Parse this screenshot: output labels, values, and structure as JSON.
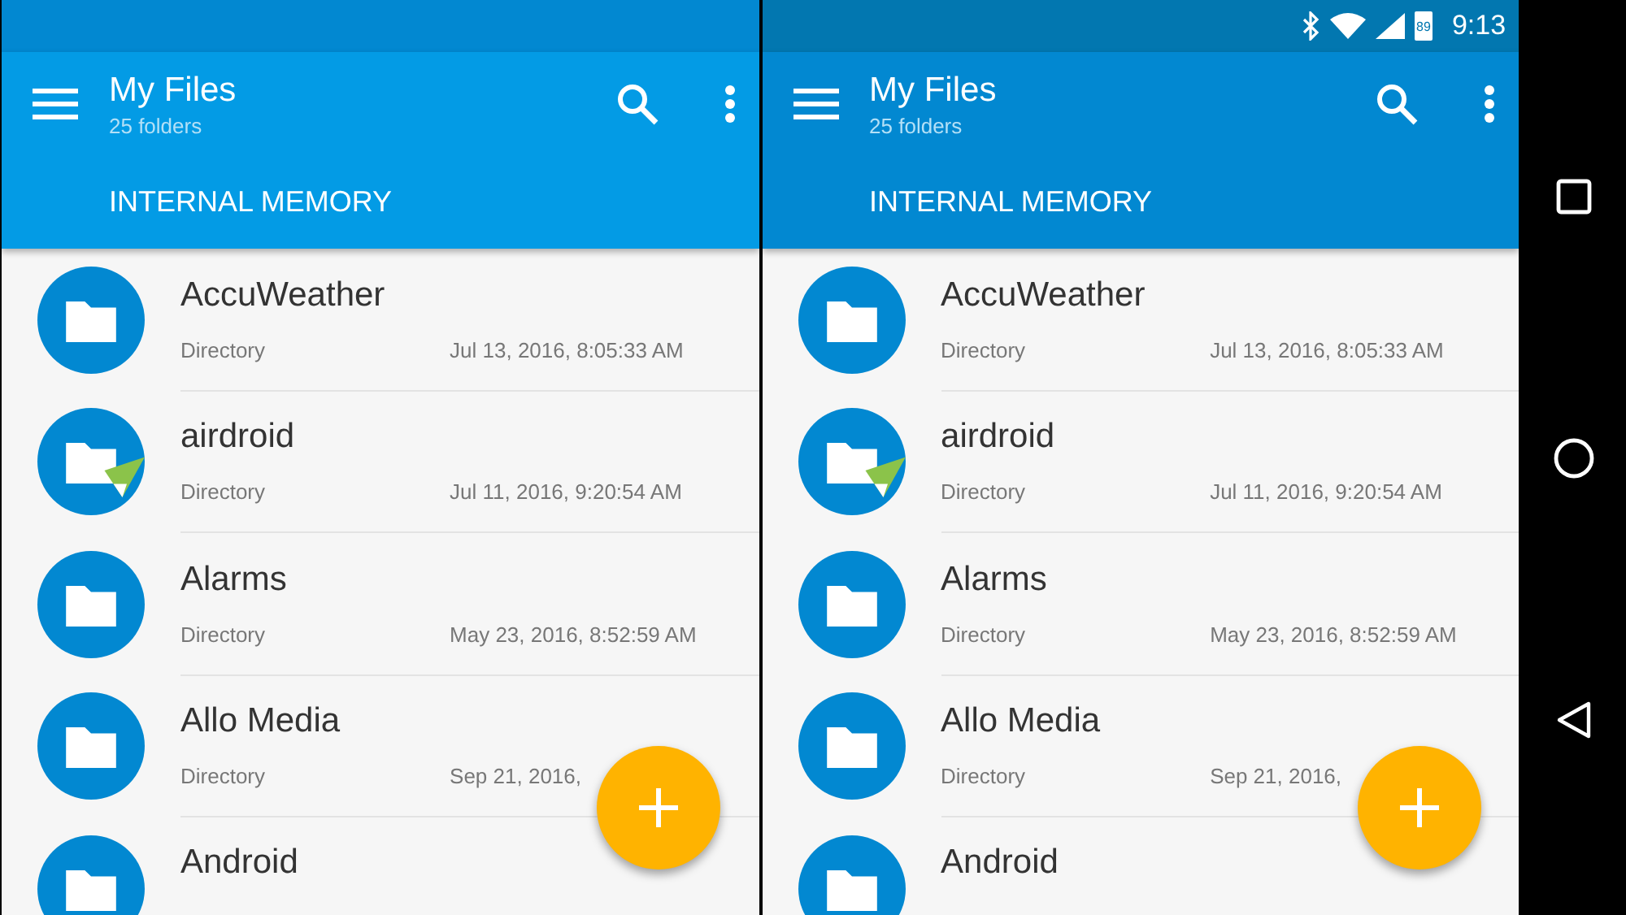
{
  "panels": [
    {
      "app_bar": {
        "title": "My Files",
        "subtitle": "25 folders",
        "tab": "INTERNAL MEMORY"
      },
      "files": [
        {
          "name": "AccuWeather",
          "type": "Directory",
          "date": "Jul 13, 2016, 8:05:33 AM",
          "kind": "folder"
        },
        {
          "name": "airdroid",
          "type": "Directory",
          "date": "Jul 11, 2016, 9:20:54 AM",
          "kind": "badged"
        },
        {
          "name": "Alarms",
          "type": "Directory",
          "date": "May 23, 2016, 8:52:59 AM",
          "kind": "folder"
        },
        {
          "name": "Allo Media",
          "type": "Directory",
          "date": "Sep 21, 2016,",
          "kind": "folder"
        },
        {
          "name": "Android",
          "kind": "folder"
        }
      ]
    },
    {
      "status_bar": {
        "battery": "89",
        "time": "9:13"
      },
      "app_bar": {
        "title": "My Files",
        "subtitle": "25 folders",
        "tab": "INTERNAL MEMORY"
      },
      "files": [
        {
          "name": "AccuWeather",
          "type": "Directory",
          "date": "Jul 13, 2016, 8:05:33 AM",
          "kind": "folder"
        },
        {
          "name": "airdroid",
          "type": "Directory",
          "date": "Jul 11, 2016, 9:20:54 AM",
          "kind": "badged"
        },
        {
          "name": "Alarms",
          "type": "Directory",
          "date": "May 23, 2016, 8:52:59 AM",
          "kind": "folder"
        },
        {
          "name": "Allo Media",
          "type": "Directory",
          "date": "Sep 21, 2016,",
          "kind": "folder"
        },
        {
          "name": "Android",
          "kind": "folder"
        }
      ]
    }
  ]
}
